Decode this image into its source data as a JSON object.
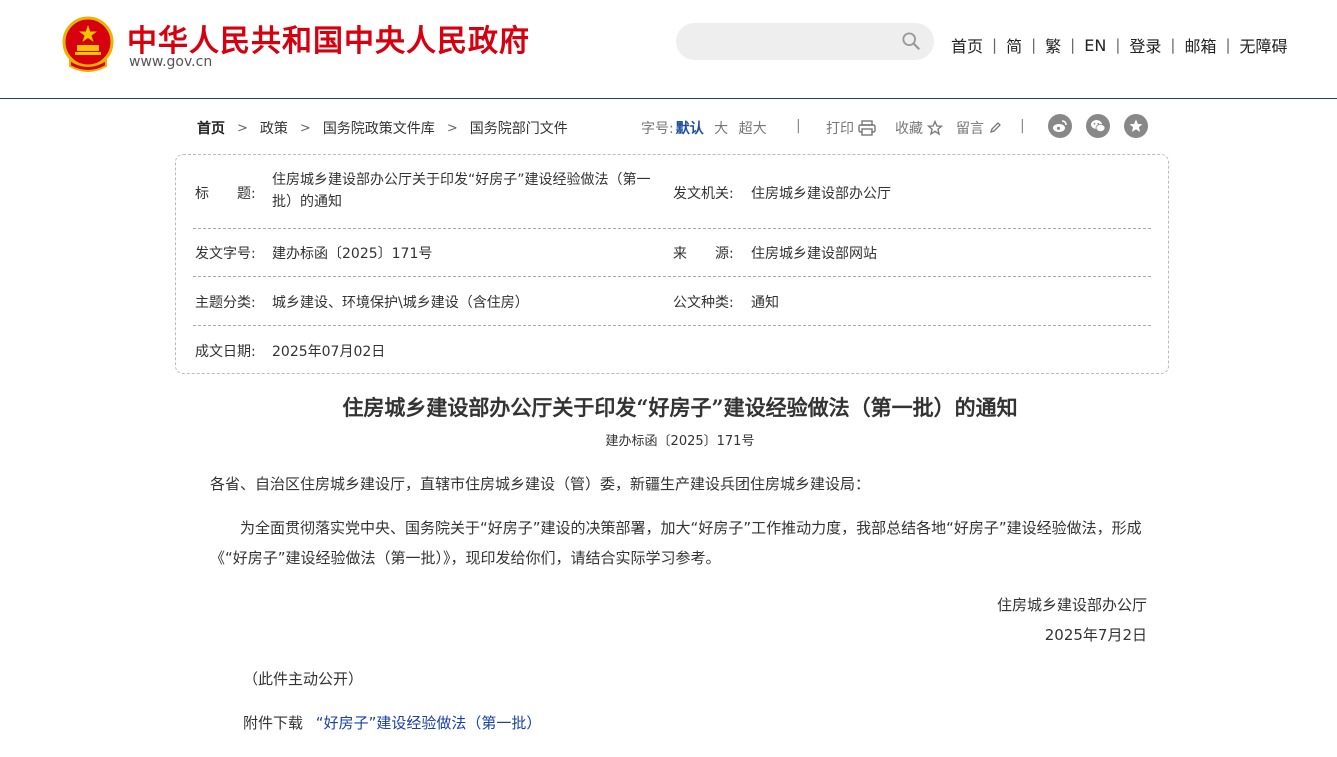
{
  "header": {
    "site_title": "中华人民共和国中央人民政府",
    "site_domain": "www.gov.cn",
    "search_placeholder": "",
    "nav": [
      "首页",
      "简",
      "繁",
      "EN",
      "登录",
      "邮箱",
      "无障碍"
    ],
    "nav_sep": "|"
  },
  "breadcrumb": [
    "首页",
    "政策",
    "国务院政策文件库",
    "国务院部门文件"
  ],
  "breadcrumb_sep": ">",
  "tools": {
    "fontsize_label": "字号:",
    "fontsize_default": "默认",
    "fontsize_large": "大",
    "fontsize_xlarge": "超大",
    "bar": "|",
    "print": "打印",
    "favorite": "收藏",
    "comment": "留言"
  },
  "meta": {
    "title_label": "标　　题:",
    "title_value": "住房城乡建设部办公厅关于印发“好房子”建设经验做法（第一批）的通知",
    "issuer_label": "发文机关:",
    "issuer_value": "住房城乡建设部办公厅",
    "docno_label": "发文字号:",
    "docno_value": "建办标函〔2025〕171号",
    "source_label": "来　　源:",
    "source_value": "住房城乡建设部网站",
    "topic_label": "主题分类:",
    "topic_value": "城乡建设、环境保护\\城乡建设（含住房）",
    "type_label": "公文种类:",
    "type_value": "通知",
    "date_label": "成文日期:",
    "date_value": "2025年07月02日"
  },
  "doc": {
    "title": "住房城乡建设部办公厅关于印发“好房子”建设经验做法（第一批）的通知",
    "number": "建办标函〔2025〕171号",
    "salutation": "各省、自治区住房城乡建设厅，直辖市住房城乡建设（管）委，新疆生产建设兵团住房城乡建设局：",
    "body": "　　为全面贯彻落实党中央、国务院关于“好房子”建设的决策部署，加大“好房子”工作推动力度，我部总结各地“好房子”建设经验做法，形成《“好房子”建设经验做法（第一批）》，现印发给你们，请结合实际学习参考。",
    "signer": "住房城乡建设部办公厅",
    "sign_date": "2025年7月2日",
    "public_note": "（此件主动公开）",
    "attach_label": "附件下载",
    "attach_link": "“好房子”建设经验做法（第一批）"
  },
  "colors": {
    "brand_red": "#d7000f",
    "link_blue": "#1a3fae",
    "header_line": "#1f3f5b"
  },
  "icons": [
    "national-emblem-icon",
    "search-icon",
    "print-icon",
    "star-icon",
    "pencil-icon",
    "weibo-icon",
    "wechat-icon",
    "favorite-star-icon"
  ]
}
